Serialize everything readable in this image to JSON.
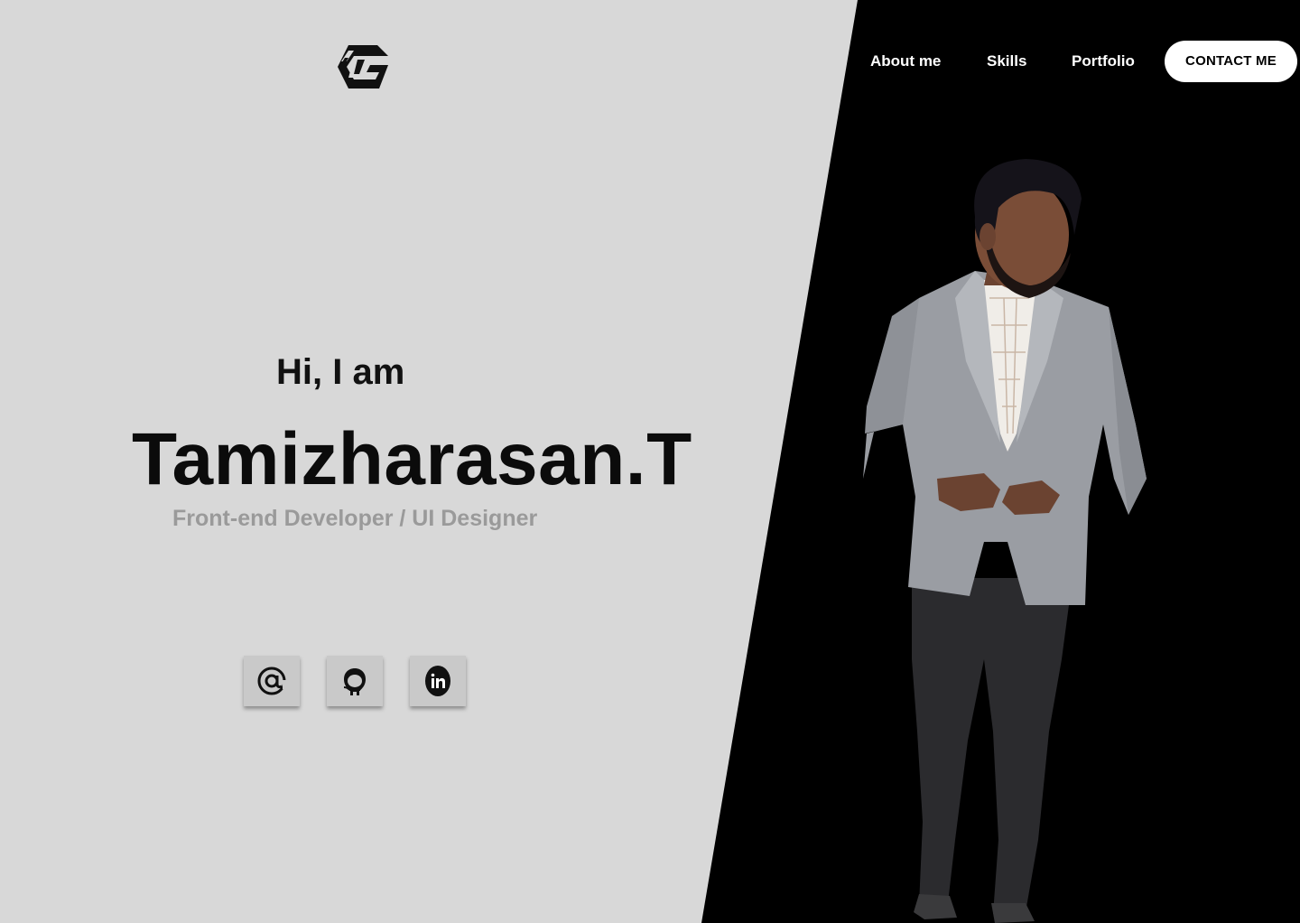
{
  "nav": {
    "items": [
      {
        "label": "About me"
      },
      {
        "label": "Skills"
      },
      {
        "label": "Portfolio"
      }
    ],
    "contact_label": "CONTACT ME"
  },
  "logo": {
    "icon": "tg-monogram-logo"
  },
  "hero": {
    "greeting": "Hi, I am",
    "name": "Tamizharasan.T",
    "role": "Front-end Developer / UI Designer"
  },
  "social": [
    {
      "icon": "at-sign-icon"
    },
    {
      "icon": "github-icon"
    },
    {
      "icon": "linkedin-icon"
    }
  ],
  "colors": {
    "background_light": "#d8d8d8",
    "background_dark": "#000000",
    "role_text": "#9a9a9a"
  }
}
